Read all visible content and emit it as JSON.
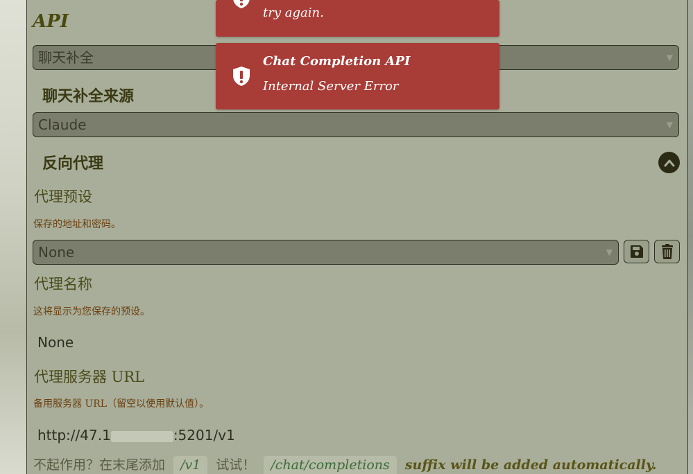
{
  "api": {
    "heading": "API",
    "selected": "聊天补全"
  },
  "chat_source": {
    "heading": "聊天补全来源",
    "selected": "Claude"
  },
  "reverse_proxy": {
    "heading": "反向代理",
    "preset": {
      "label": "代理预设",
      "hint": "保存的地址和密码。",
      "selected": "None"
    },
    "name": {
      "label": "代理名称",
      "hint": "这将显示为您保存的预设。",
      "value": "None"
    },
    "server_url": {
      "label": "代理服务器 URL",
      "hint": "备用服务器 URL（留空以使用默认值）。",
      "value_prefix": "http://47.1",
      "value_suffix": ":5201/v1"
    },
    "footer": {
      "text1": "不起作用？在末尾添加",
      "code1": "/v1",
      "text2": "试试！",
      "code2": "/chat/completions",
      "text3": "suffix will be added automatically."
    }
  },
  "toasts": [
    {
      "message": "try again."
    },
    {
      "title": "Chat Completion API",
      "message": "Internal Server Error"
    }
  ],
  "colors": {
    "panel": "#a8ae99",
    "toast": "#a83c37",
    "select": "#7b7e6d",
    "accent_dark": "#2b2a15"
  },
  "icons": {
    "caret": "caret-down-icon",
    "collapse": "chevron-up-icon",
    "save": "floppy-disk-icon",
    "delete": "trash-icon",
    "warning": "shield-exclamation-icon"
  }
}
